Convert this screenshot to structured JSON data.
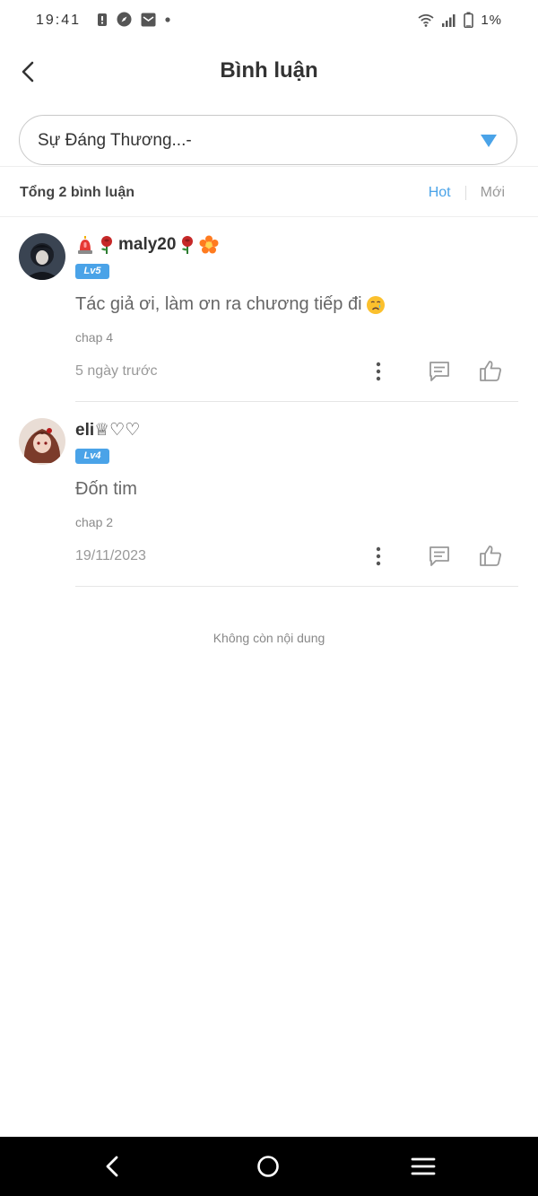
{
  "status_bar": {
    "time": "19:41",
    "battery": "1%"
  },
  "header": {
    "title": "Bình luận"
  },
  "selector": {
    "value": "Sự Đáng Thương...-"
  },
  "summary": {
    "total": "Tổng 2 bình luận",
    "sort_hot": "Hot",
    "sort_new": "Mới"
  },
  "comments": [
    {
      "username": "maly20",
      "level": "Lv5",
      "text": "Tác giả ơi, làm ơn ra chương tiếp đi",
      "chapter": "chap 4",
      "time": "5 ngày trước"
    },
    {
      "username": "eli♕♡♡",
      "level": "Lv4",
      "text": "Đốn tim",
      "chapter": "chap 2",
      "time": "19/11/2023"
    }
  ],
  "footer": {
    "no_more": "Không còn nội dung"
  },
  "colors": {
    "accent": "#4aa3e8",
    "nav_bar": "#000000"
  }
}
